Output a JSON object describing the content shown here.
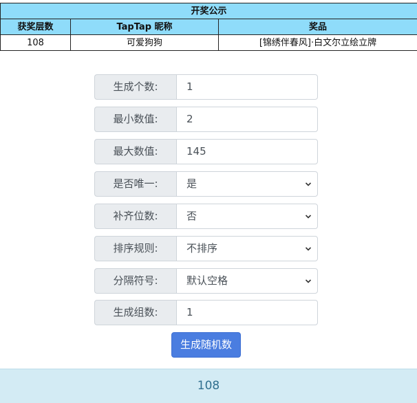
{
  "winners_table": {
    "title": "开奖公示",
    "headers": [
      "获奖层数",
      "TapTap 昵称",
      "奖品"
    ],
    "rows": [
      [
        "108",
        "可爱狗狗",
        "[锦绣伴春风]·白文尔立绘立牌"
      ]
    ]
  },
  "form": {
    "count": {
      "label": "生成个数:",
      "value": "1"
    },
    "min": {
      "label": "最小数值:",
      "value": "2"
    },
    "max": {
      "label": "最大数值:",
      "value": "145"
    },
    "unique": {
      "label": "是否唯一:",
      "value": "是"
    },
    "pad": {
      "label": "补齐位数:",
      "value": "否"
    },
    "sort": {
      "label": "排序规则:",
      "value": "不排序"
    },
    "separator": {
      "label": "分隔符号:",
      "value": "默认空格"
    },
    "groups": {
      "label": "生成组数:",
      "value": "1"
    }
  },
  "generate_button": {
    "label": "生成随机数"
  },
  "result": {
    "value": "108"
  },
  "colors": {
    "table_header_bg": "#8fdcfa",
    "button_bg": "#4a7de0",
    "result_bg": "#d3ebf4",
    "result_text": "#31708f"
  }
}
